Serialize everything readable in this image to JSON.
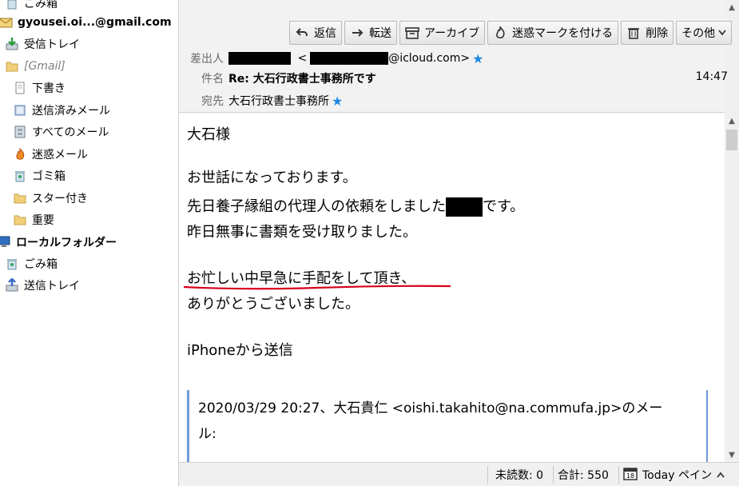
{
  "folders": [
    {
      "label": "ごみ箱",
      "icon": "trash-icon"
    },
    {
      "label": "gyousei.oi...@gmail.com",
      "icon": "mail-account-icon"
    },
    {
      "label": "受信トレイ",
      "icon": "inbox-icon"
    },
    {
      "label": "[Gmail]",
      "icon": "folder-icon"
    },
    {
      "label": "下書き",
      "icon": "drafts-icon"
    },
    {
      "label": "送信済みメール",
      "icon": "sent-icon"
    },
    {
      "label": "すべてのメール",
      "icon": "archive-icon"
    },
    {
      "label": "迷惑メール",
      "icon": "junk-icon"
    },
    {
      "label": "ゴミ箱",
      "icon": "trash-icon"
    },
    {
      "label": "スター付き",
      "icon": "folder-icon"
    },
    {
      "label": "重要",
      "icon": "folder-icon"
    },
    {
      "label": "ローカルフォルダー",
      "icon": "computer-icon"
    },
    {
      "label": "ごみ箱",
      "icon": "trash-icon"
    },
    {
      "label": "送信トレイ",
      "icon": "outbox-icon"
    }
  ],
  "toolbar": {
    "reply": "返信",
    "forward": "転送",
    "archive": "アーカイブ",
    "junk": "迷惑マークを付ける",
    "delete": "削除",
    "more": "その他"
  },
  "header": {
    "from_label": "差出人",
    "from_email_suffix": "@icloud.com>",
    "from_open": "<",
    "subject_label": "件名",
    "subject": "Re: 大石行政書士事務所です",
    "time": "14:47",
    "to_label": "宛先",
    "to": "大石行政書士事務所"
  },
  "body": {
    "greeting": "大石様",
    "line1": "お世話になっております。",
    "line2_a": "先日養子縁組の代理人の依頼をしました",
    "line2_b": "です。",
    "line3": "昨日無事に書類を受け取りました。",
    "line4": "お忙しい中早急に手配をして頂き、",
    "line5": "ありがとうございました。",
    "signature": "iPhoneから送信",
    "quote_line1": "2020/03/29 20:27、大石貴仁 <oishi.takahito@na.commufa.jp>のメー",
    "quote_line2": "ル:"
  },
  "status": {
    "unread": "未読数: 0",
    "total": "合計: 550",
    "today_pane": "Today ペイン"
  },
  "colors": {
    "accent_underline": "#d6001c",
    "quote_border": "#6e9bd6",
    "star": "#1e88e5"
  }
}
